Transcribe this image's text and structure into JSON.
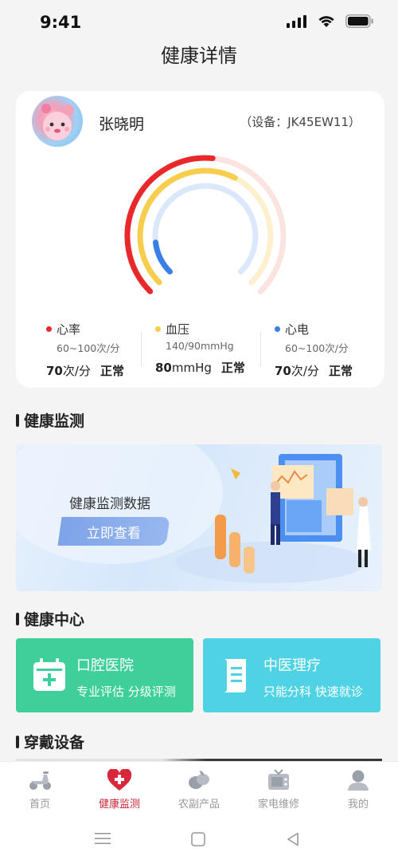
{
  "status_bar": {
    "time": "9:41"
  },
  "header": {
    "title": "健康详情"
  },
  "profile": {
    "name": "张晓明",
    "device": "（设备：JK45EW11）"
  },
  "gauge": {
    "rings": [
      {
        "name": "心率",
        "color": "#e8282a",
        "track_color": "#fbe3df",
        "fraction": 0.52
      },
      {
        "name": "血压",
        "color": "#f7cd4d",
        "track_color": "#fdf0cf",
        "fraction": 0.6
      },
      {
        "name": "心电",
        "color": "#3a7ee8",
        "track_color": "#dbe7fb",
        "fraction": 0.14
      }
    ]
  },
  "metrics": [
    {
      "label": "心率",
      "range": "60~100次/分",
      "value": "70",
      "unit": "次/分",
      "status": "正常",
      "color": "#e8282a"
    },
    {
      "label": "血压",
      "range": "140/90mmHg",
      "value": "80",
      "unit": "mmHg",
      "status": "正常",
      "color": "#f7cd4d"
    },
    {
      "label": "心电",
      "range": "60~100次/分",
      "value": "70",
      "unit": "次/分",
      "status": "正常",
      "color": "#3a7ee8"
    }
  ],
  "sections": {
    "monitor": "健康监测",
    "center": "健康中心",
    "wearable": "穿戴设备"
  },
  "banner": {
    "title": "健康监测数据",
    "button": "立即查看"
  },
  "centers": [
    {
      "title": "口腔医院",
      "subtitle": "专业评估 分级评测",
      "color": "#3fcf9a",
      "icon": "calendar-plus-icon"
    },
    {
      "title": "中医理疗",
      "subtitle": "只能分科 快速就诊",
      "color": "#4fd2e4",
      "icon": "scroll-icon"
    }
  ],
  "tabs": [
    {
      "label": "首页",
      "icon": "scooter-icon",
      "active": false
    },
    {
      "label": "健康监测",
      "icon": "heart-plus-icon",
      "active": true
    },
    {
      "label": "农副产品",
      "icon": "produce-icon",
      "active": false
    },
    {
      "label": "家电维修",
      "icon": "tv-icon",
      "active": false
    },
    {
      "label": "我的",
      "icon": "user-icon",
      "active": false
    }
  ],
  "colors": {
    "accent": "#c8273a"
  }
}
